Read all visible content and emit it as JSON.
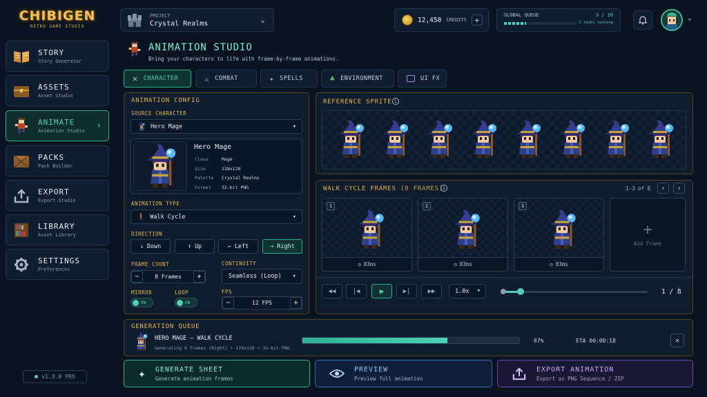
{
  "brand": {
    "name": "CHIBIGEN",
    "tagline": "RETRO GAME STUDIO"
  },
  "sidebar": {
    "items": [
      {
        "label": "STORY",
        "sub": "Story Generator",
        "icon": "book-icon"
      },
      {
        "label": "ASSETS",
        "sub": "Asset Studio",
        "icon": "chest-icon"
      },
      {
        "label": "ANIMATE",
        "sub": "Animation Studio",
        "icon": "running-character-icon",
        "active": true
      },
      {
        "label": "PACKS",
        "sub": "Pack Builder",
        "icon": "crate-icon"
      },
      {
        "label": "EXPORT",
        "sub": "Export Studio",
        "icon": "upload-icon"
      },
      {
        "label": "LIBRARY",
        "sub": "Asset Library",
        "icon": "bookshelf-icon"
      },
      {
        "label": "SETTINGS",
        "sub": "Preferences",
        "icon": "gear-icon"
      }
    ],
    "version": "v1.3.0",
    "plan": "PRO"
  },
  "topbar": {
    "project_label": "PROJECT",
    "project_value": "Crystal Realms",
    "credits": "12,450",
    "credits_label": "CREDITS",
    "queue_label": "GLOBAL QUEUE",
    "queue_count": "3 / 10",
    "queue_status": "3 tasks running",
    "queue_progress": 0.3
  },
  "header": {
    "title": "ANIMATION STUDIO",
    "subtitle": "Bring your characters to life with frame-by-frame animations."
  },
  "tabs": [
    {
      "label": "CHARACTER",
      "icon": "crossed-swords-icon",
      "active": true
    },
    {
      "label": "COMBAT",
      "icon": "sword-icon"
    },
    {
      "label": "SPELLS",
      "icon": "sparkle-icon"
    },
    {
      "label": "ENVIRONMENT",
      "icon": "tree-icon"
    },
    {
      "label": "UI FX",
      "icon": "ui-window-icon"
    }
  ],
  "config": {
    "heading": "ANIMATION CONFIG",
    "source_label": "SOURCE CHARACTER",
    "source_value": "Hero Mage",
    "card": {
      "name": "Hero Mage",
      "fields": [
        {
          "k": "Class",
          "v": "Mage"
        },
        {
          "k": "Size",
          "v": "128x128"
        },
        {
          "k": "Palette",
          "v": "Crystal Realms"
        },
        {
          "k": "Format",
          "v": "32-bit PNG"
        }
      ]
    },
    "type_label": "ANIMATION TYPE",
    "type_value": "Walk Cycle",
    "direction_label": "DIRECTION",
    "directions": [
      {
        "label": "Down",
        "arrow": "↓"
      },
      {
        "label": "Up",
        "arrow": "↑"
      },
      {
        "label": "Left",
        "arrow": "←"
      },
      {
        "label": "Right",
        "arrow": "→",
        "active": true
      }
    ],
    "frame_count_label": "FRAME COUNT",
    "frame_count_value": "8 Frames",
    "continuity_label": "CONTINUITY",
    "continuity_value": "Seamless (Loop)",
    "mirror_label": "MIRROR",
    "mirror_state": "ON",
    "loop_label": "LOOP",
    "loop_state": "ON",
    "fps_label": "FPS",
    "fps_value": "12 FPS"
  },
  "reference": {
    "heading": "REFERENCE SPRITE",
    "info_icon": "info-icon"
  },
  "frames": {
    "heading": "WALK CYCLE FRAMES",
    "count_note": "(8 FRAMES)",
    "pager": "1-3 of 8",
    "items": [
      {
        "num": "1",
        "duration": "83ms"
      },
      {
        "num": "2",
        "duration": "83ms"
      },
      {
        "num": "3",
        "duration": "83ms"
      }
    ],
    "add_label": "Add Frame"
  },
  "player": {
    "speed": "1.0x",
    "position": "1 / 8",
    "progress": 0.125
  },
  "gen_queue": {
    "heading": "GENERATION QUEUE",
    "task_title": "HERO MAGE — WALK CYCLE",
    "task_sub": "Generating 8 frames (Right) • 128x128 • 32-bit PNG",
    "percent": "67%",
    "progress": 0.67,
    "eta": "ETA 00:00:18"
  },
  "actions": [
    {
      "label": "GENERATE SHEET",
      "sub": "Generate animation frames",
      "icon": "sparkle-icon"
    },
    {
      "label": "PREVIEW",
      "sub": "Preview full animation",
      "icon": "eye-icon"
    },
    {
      "label": "EXPORT ANIMATION",
      "sub": "Export as PNG Sequence / ZIP",
      "icon": "upload-icon"
    }
  ],
  "colors": {
    "accent": "#4fd1b5",
    "gold": "#e8b64a",
    "bg": "#091420",
    "panel": "#0f1d2e",
    "preview": "#5ab0ff",
    "export": "#b98cf0"
  }
}
